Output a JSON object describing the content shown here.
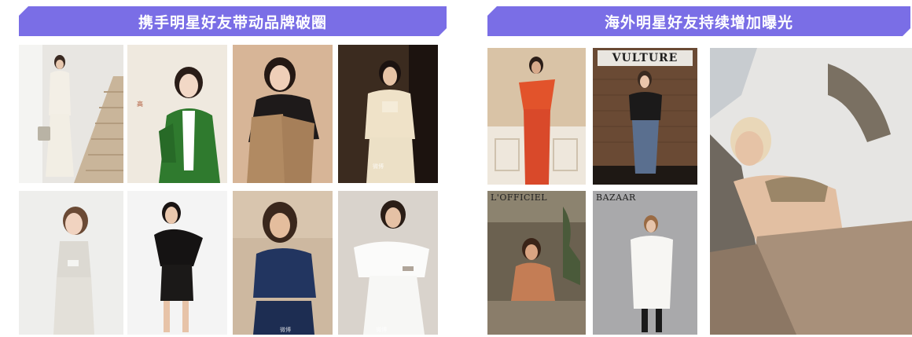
{
  "left_banner": {
    "title": "携手明星好友带动品牌破圈"
  },
  "right_banner": {
    "title": "海外明星好友持续增加曝光"
  },
  "photos": {
    "p5_sign": "VULTURE",
    "p7_mag": "L'OFFICIEL",
    "p8_mag": "BAZAAR"
  },
  "colors": {
    "banner": "#7a6ee6",
    "banner_text": "#ffffff"
  }
}
